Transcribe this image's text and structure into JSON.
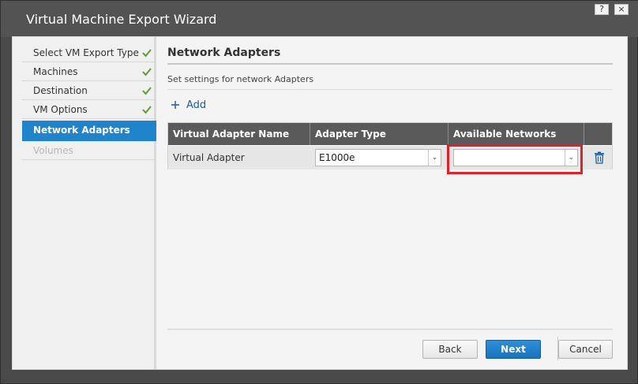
{
  "window": {
    "title": "Virtual Machine Export Wizard",
    "help_label": "?",
    "close_label": "×"
  },
  "sidebar": {
    "items": [
      {
        "label": "Select VM Export Type",
        "state": "done"
      },
      {
        "label": "Machines",
        "state": "done"
      },
      {
        "label": "Destination",
        "state": "done"
      },
      {
        "label": "VM Options",
        "state": "done"
      },
      {
        "label": "Network Adapters",
        "state": "active"
      },
      {
        "label": "Volumes",
        "state": "disabled"
      }
    ]
  },
  "main": {
    "title": "Network Adapters",
    "description": "Set settings for network Adapters",
    "add_label": "Add",
    "grid": {
      "columns": [
        "Virtual Adapter Name",
        "Adapter Type",
        "Available Networks"
      ],
      "rows": [
        {
          "name": "Virtual Adapter",
          "adapter_type": "E1000e",
          "network": ""
        }
      ]
    }
  },
  "footer": {
    "back_label": "Back",
    "next_label": "Next",
    "cancel_label": "Cancel"
  },
  "colors": {
    "accent": "#1f84cc",
    "highlight": "#e0202b",
    "check": "#5aa02c"
  },
  "icons": {
    "check": "check-icon",
    "add": "plus-icon",
    "delete": "trash-icon",
    "dropdown": "chevron-down-icon"
  }
}
